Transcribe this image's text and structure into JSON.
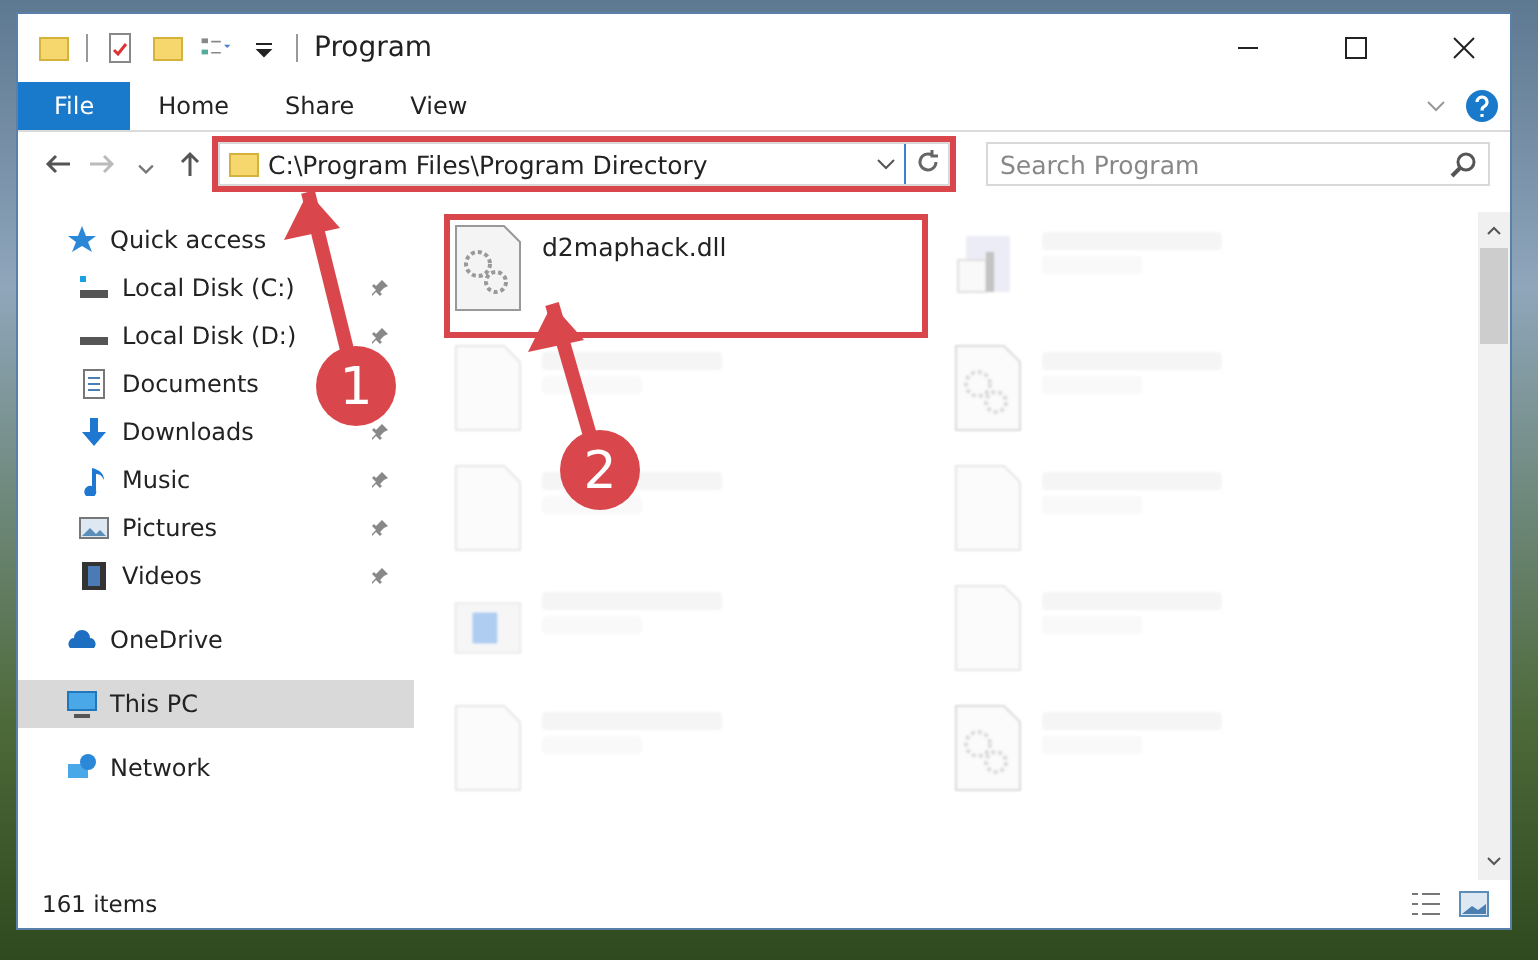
{
  "window": {
    "title": "Program"
  },
  "ribbon_tabs": [
    {
      "label": "File",
      "selected": true
    },
    {
      "label": "Home",
      "selected": false
    },
    {
      "label": "Share",
      "selected": false
    },
    {
      "label": "View",
      "selected": false
    }
  ],
  "address_bar": {
    "path": "C:\\Program Files\\Program Directory",
    "highlighted": true
  },
  "search": {
    "placeholder": "Search Program"
  },
  "sidebar": {
    "items": [
      {
        "label": "Quick access",
        "kind": "star",
        "selected": false,
        "children": [
          {
            "label": "Local Disk (C:)",
            "kind": "drive-c",
            "pinned": true,
            "selected": false
          },
          {
            "label": "Local Disk (D:)",
            "kind": "drive",
            "pinned": true,
            "selected": false
          },
          {
            "label": "Documents",
            "kind": "documents",
            "pinned": false,
            "selected": false
          },
          {
            "label": "Downloads",
            "kind": "downloads",
            "pinned": true,
            "selected": false
          },
          {
            "label": "Music",
            "kind": "music",
            "pinned": true,
            "selected": false
          },
          {
            "label": "Pictures",
            "kind": "pictures",
            "pinned": true,
            "selected": false
          },
          {
            "label": "Videos",
            "kind": "videos",
            "pinned": true,
            "selected": false
          }
        ]
      },
      {
        "label": "OneDrive",
        "kind": "cloud",
        "selected": false
      },
      {
        "label": "This PC",
        "kind": "pc",
        "selected": true
      },
      {
        "label": "Network",
        "kind": "network",
        "selected": false
      }
    ]
  },
  "files": [
    {
      "name": "d2maphack.dll",
      "kind": "dll",
      "highlighted": true,
      "dimmed": false
    },
    {
      "kind": "app",
      "highlighted": false,
      "dimmed": true
    },
    {
      "kind": "blank",
      "highlighted": false,
      "dimmed": true
    },
    {
      "kind": "dll",
      "highlighted": false,
      "dimmed": true
    },
    {
      "kind": "blank",
      "highlighted": false,
      "dimmed": true
    },
    {
      "kind": "blank",
      "highlighted": false,
      "dimmed": true
    },
    {
      "kind": "exe",
      "highlighted": false,
      "dimmed": true
    },
    {
      "kind": "blank",
      "highlighted": false,
      "dimmed": true
    },
    {
      "kind": "blank",
      "highlighted": false,
      "dimmed": true
    },
    {
      "kind": "dll",
      "highlighted": false,
      "dimmed": true
    }
  ],
  "status_bar": {
    "item_count": "161 items"
  },
  "callouts": [
    {
      "number": "1"
    },
    {
      "number": "2"
    }
  ]
}
